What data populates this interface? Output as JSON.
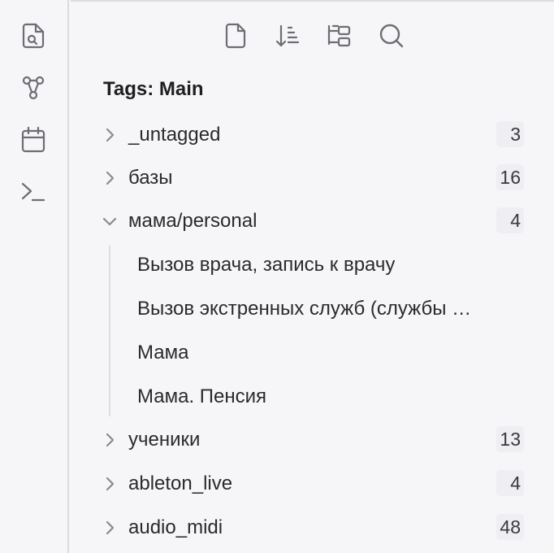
{
  "ribbon": {
    "items": [
      {
        "icon": "file-search-icon"
      },
      {
        "icon": "graph-icon"
      },
      {
        "icon": "calendar-icon"
      },
      {
        "icon": "terminal-icon"
      }
    ]
  },
  "toolbar": {
    "items": [
      {
        "icon": "new-note-icon"
      },
      {
        "icon": "sort-icon"
      },
      {
        "icon": "collapse-tree-icon"
      },
      {
        "icon": "search-icon"
      }
    ]
  },
  "pane": {
    "title": "Tags: Main"
  },
  "tags": [
    {
      "label": "_untagged",
      "count": "3",
      "expanded": false
    },
    {
      "label": "базы",
      "count": "16",
      "expanded": false
    },
    {
      "label": "мама/personal",
      "count": "4",
      "expanded": true,
      "notes": [
        "Вызов врача, запись к врачу",
        "Вызов экстренных служб (службы …",
        "Мама",
        "Мама. Пенсия"
      ]
    },
    {
      "label": "ученики",
      "count": "13",
      "expanded": false
    },
    {
      "label": "ableton_live",
      "count": "4",
      "expanded": false
    },
    {
      "label": "audio_midi",
      "count": "48",
      "expanded": false
    }
  ],
  "colors": {
    "background": "#f6f5f8",
    "icon": "#6d6d73",
    "count_badge": "#efeef2",
    "divider": "#dcdbe0"
  }
}
